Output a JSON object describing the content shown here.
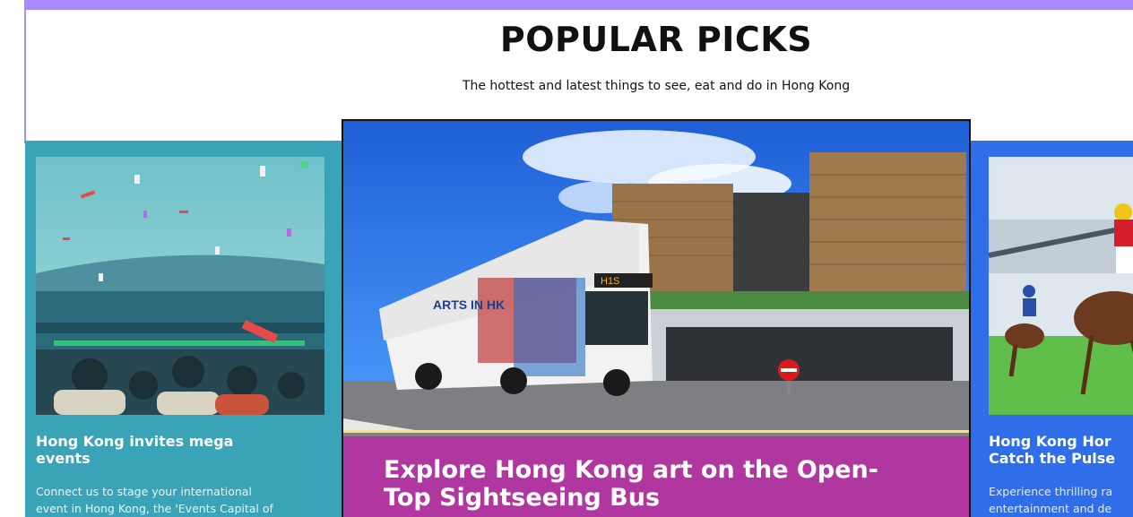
{
  "header": {
    "title": "POPULAR PICKS",
    "subtitle": "The hottest and latest things to see, eat and do in Hong Kong"
  },
  "cards": [
    {
      "title_lines": [
        "Hong Kong invites mega",
        "events"
      ],
      "desc_lines": [
        "Connect us to stage your international",
        "event in Hong Kong, the 'Events Capital of"
      ]
    },
    {
      "title_lines": [
        "Explore Hong Kong art on the Open-",
        "Top Sightseeing Bus"
      ]
    },
    {
      "title_lines": [
        "Hong Kong Hor",
        "Catch the Pulse"
      ],
      "desc_lines": [
        "Experience thrilling ra",
        "entertainment and de"
      ]
    }
  ],
  "bus_signage": {
    "brand": "ARTS IN HK",
    "route": "H1S"
  },
  "colors": {
    "accent_bar": "#a78bfa",
    "card_left_bg": "#3aa3b7",
    "card_center_caption": "#b0379f",
    "card_right_bg": "#2f6ee8"
  }
}
